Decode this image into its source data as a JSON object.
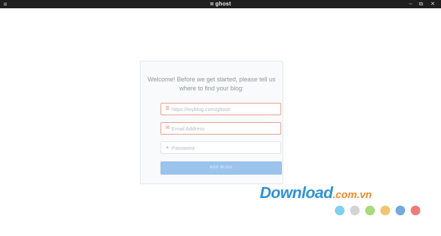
{
  "window": {
    "title": "ghost",
    "controls": {
      "menu": "≡",
      "minimize": "–",
      "maximize": "⧉",
      "close": "✕"
    }
  },
  "setup": {
    "welcome": "Welcome! Before we get started, please tell us where to find your blog:",
    "url_field": {
      "placeholder": "https://myblog.com/ghost/",
      "value": "",
      "icon": "link-icon",
      "state": "error"
    },
    "email_field": {
      "placeholder": "Email Address",
      "value": "",
      "icon": "mail-icon",
      "state": "error"
    },
    "password_field": {
      "placeholder": "Password",
      "value": "",
      "icon": "lock-icon",
      "state": "normal"
    },
    "submit_label": "ADD BLOG"
  },
  "watermark": {
    "text_main": "Download",
    "text_domain": ".com.vn",
    "dot_colors": [
      "#7ed0f2",
      "#d4d4d4",
      "#a8d97a",
      "#f3c36e",
      "#74a9de",
      "#ef7b7b"
    ]
  },
  "colors": {
    "error_border": "#e59c86",
    "button": "#9bc4ec",
    "titlebar": "#1f1f1f"
  }
}
